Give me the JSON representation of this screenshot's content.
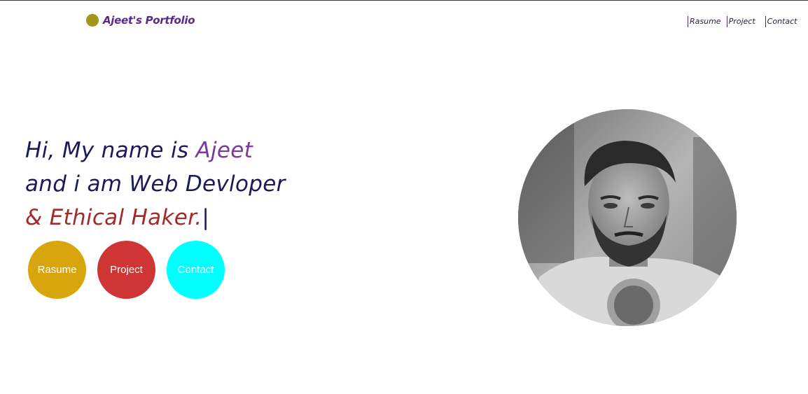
{
  "header": {
    "logo_text": "Ajeet's Portfolio",
    "nav": [
      {
        "label": "Rasume"
      },
      {
        "label": "Project"
      },
      {
        "label": "Contact"
      }
    ]
  },
  "hero": {
    "line1_prefix": "Hi, My name is ",
    "line1_name": "Ajeet",
    "line2": "and i am Web Devloper",
    "line3": "& Ethical Haker.",
    "cursor": "|"
  },
  "buttons": [
    {
      "label": "Rasume"
    },
    {
      "label": "Project"
    },
    {
      "label": "Contact"
    }
  ],
  "colors": {
    "logo_dot": "#a3961b",
    "logo_text": "#5a2a8a",
    "heading": "#1a1a5a",
    "name_accent": "#7a3a9c",
    "role_accent": "#a32a2a",
    "btn_resume": "#d8a60c",
    "btn_project": "#d03535",
    "btn_contact": "#00ffff"
  }
}
